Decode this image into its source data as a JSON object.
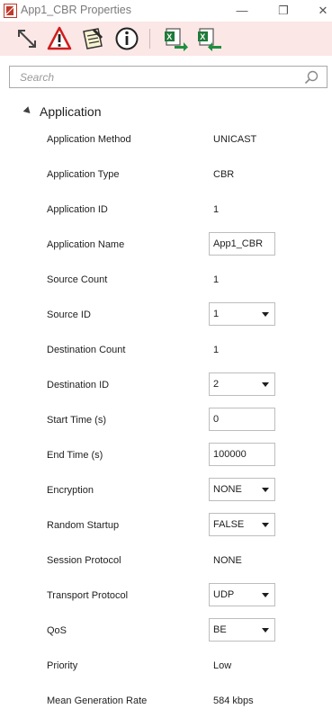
{
  "window": {
    "title": "App1_CBR Properties",
    "minimize_glyph": "—",
    "restore_glyph": "❐",
    "close_glyph": "✕"
  },
  "toolbar": {
    "icons": [
      "expand-icon",
      "warning-icon",
      "notes-icon",
      "info-icon",
      "excel-export-icon",
      "excel-import-icon"
    ]
  },
  "search": {
    "placeholder": "Search",
    "value": ""
  },
  "section": {
    "label": "Application"
  },
  "properties": [
    {
      "label": "Application Method",
      "value": "UNICAST",
      "control": "text"
    },
    {
      "label": "Application Type",
      "value": "CBR",
      "control": "text"
    },
    {
      "label": "Application ID",
      "value": "1",
      "control": "text"
    },
    {
      "label": "Application Name",
      "value": "App1_CBR",
      "control": "input"
    },
    {
      "label": "Source Count",
      "value": "1",
      "control": "text"
    },
    {
      "label": "Source ID",
      "value": "1",
      "control": "dropdown"
    },
    {
      "label": "Destination Count",
      "value": "1",
      "control": "text"
    },
    {
      "label": "Destination ID",
      "value": "2",
      "control": "dropdown"
    },
    {
      "label": "Start Time (s)",
      "value": "0",
      "control": "input"
    },
    {
      "label": "End Time (s)",
      "value": "100000",
      "control": "input"
    },
    {
      "label": "Encryption",
      "value": "NONE",
      "control": "dropdown"
    },
    {
      "label": "Random Startup",
      "value": "FALSE",
      "control": "dropdown"
    },
    {
      "label": "Session Protocol",
      "value": "NONE",
      "control": "text"
    },
    {
      "label": "Transport Protocol",
      "value": "UDP",
      "control": "dropdown"
    },
    {
      "label": "QoS",
      "value": "BE",
      "control": "dropdown"
    },
    {
      "label": "Priority",
      "value": "Low",
      "control": "text"
    },
    {
      "label": "Mean Generation Rate",
      "value": "584 kbps",
      "control": "text"
    }
  ],
  "colors": {
    "toolbar_bg": "#fbe7e6",
    "accent_red": "#c0392b",
    "border": "#bdbdbd"
  }
}
